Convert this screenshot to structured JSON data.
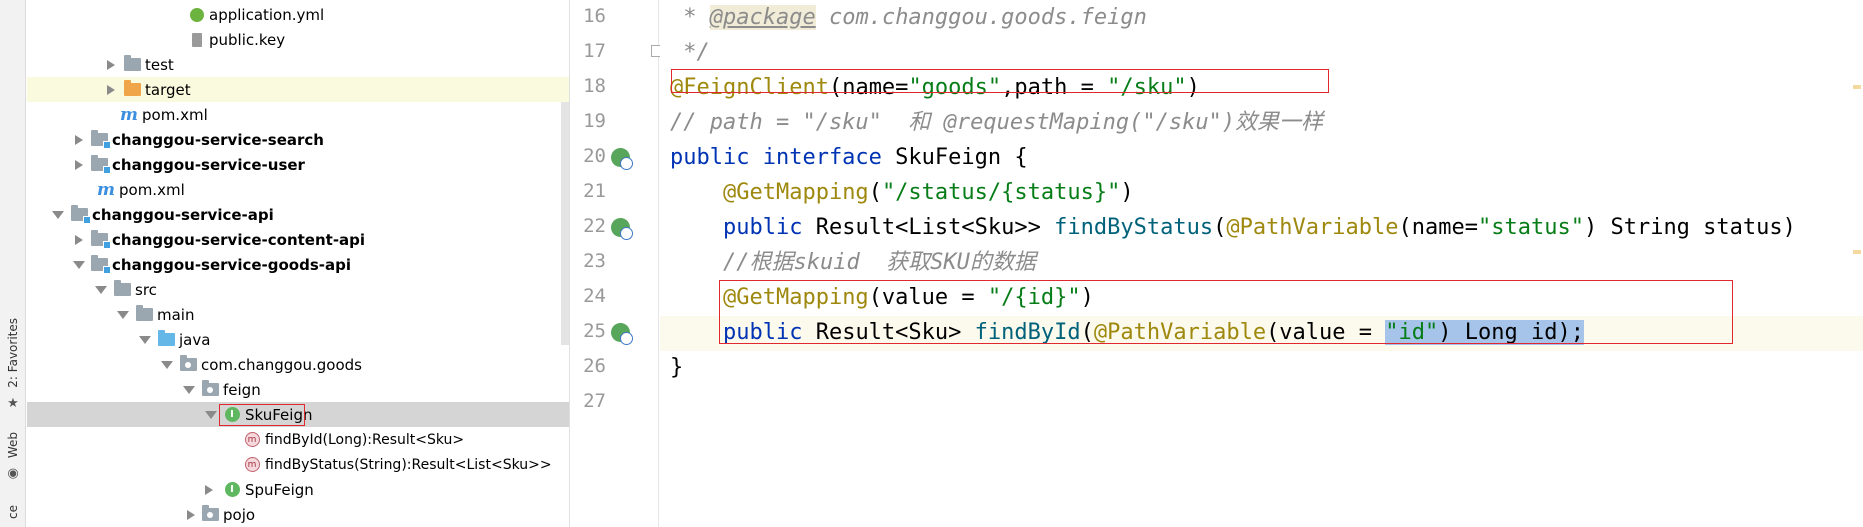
{
  "sidebar_tabs": {
    "favorites": "2: Favorites",
    "web": "Web",
    "partial": "ce"
  },
  "tree": {
    "rows": [
      {
        "label": "application.yml"
      },
      {
        "label": "public.key"
      },
      {
        "label": "test"
      },
      {
        "label": "target"
      },
      {
        "label": "pom.xml"
      },
      {
        "label": "changgou-service-search"
      },
      {
        "label": "changgou-service-user"
      },
      {
        "label": "pom.xml"
      },
      {
        "label": "changgou-service-api"
      },
      {
        "label": "changgou-service-content-api"
      },
      {
        "label": "changgou-service-goods-api"
      },
      {
        "label": "src"
      },
      {
        "label": "main"
      },
      {
        "label": "java"
      },
      {
        "label": "com.changgou.goods"
      },
      {
        "label": "feign"
      },
      {
        "label": "SkuFeign"
      },
      {
        "label": "findById(Long):Result<Sku>"
      },
      {
        "label": "findByStatus(String):Result<List<Sku>>"
      },
      {
        "label": "SpuFeign"
      },
      {
        "label": "pojo"
      }
    ]
  },
  "editor": {
    "line_numbers": [
      "16",
      "17",
      "18",
      "19",
      "20",
      "21",
      "22",
      "23",
      "24",
      "25",
      "26",
      "27"
    ],
    "lines": {
      "l16": {
        "a": " * ",
        "b": "@package",
        "c": " com.changgou.goods.feign"
      },
      "l17": {
        "a": " */"
      },
      "l18": {
        "a": "@FeignClient",
        "b": "(name=",
        "c": "\"goods\"",
        "d": ",path = ",
        "e": "\"/sku\"",
        "f": ")"
      },
      "l19": {
        "a": "// path = \"/sku\"  和 @requestMaping(\"/sku\")效果一样"
      },
      "l20": {
        "a": "public interface ",
        "b": "SkuFeign {"
      },
      "l21": {
        "a": "    ",
        "b": "@GetMapping",
        "c": "(",
        "d": "\"/status/{status}\"",
        "e": ")"
      },
      "l22": {
        "a": "    public ",
        "b": "Result<List<Sku>> ",
        "c": "findByStatus",
        "d": "(",
        "e": "@PathVariable",
        "f": "(name=",
        "g": "\"status\"",
        "h": ") String status)"
      },
      "l23": {
        "a": "    //根据skuid  获取SKU的数据"
      },
      "l24": {
        "a": "    ",
        "b": "@GetMapping",
        "c": "(value = ",
        "d": "\"/{id}\"",
        "e": ")"
      },
      "l25": {
        "a": "    public ",
        "b": "Result<Sku> ",
        "c": "findById",
        "d": "(",
        "e": "@PathVariable",
        "f": "(value = ",
        "g": "\"id\"",
        "h": ") Long id);"
      },
      "l26": {
        "a": "}"
      }
    }
  },
  "colors": {
    "annotation": "#9e880d",
    "string": "#067d17",
    "keyword": "#0033b3",
    "function": "#00627a",
    "comment": "#8c8c8c",
    "highlight_box": "#e0282e",
    "selection": "#a6c4ea"
  }
}
